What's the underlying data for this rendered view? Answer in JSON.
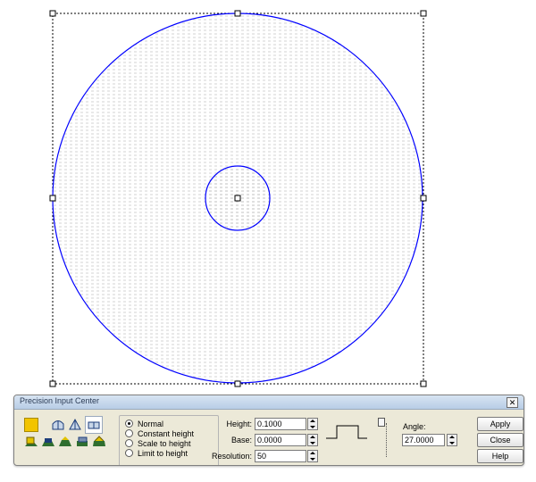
{
  "dialog": {
    "title": "Precision Input Center",
    "close_glyph": "✕",
    "modes": [
      {
        "label": "Normal",
        "selected": true
      },
      {
        "label": "Constant height",
        "selected": false
      },
      {
        "label": "Scale to height",
        "selected": false
      },
      {
        "label": "Limit to height",
        "selected": false
      }
    ],
    "fields": {
      "height_label": "Height:",
      "height_value": "0.1000",
      "base_label": "Base:",
      "base_value": "0.0000",
      "resolution_label": "Resolution:",
      "resolution_value": "50",
      "angle_label": "Angle:",
      "angle_value": "27.0000"
    },
    "buttons": {
      "apply": "Apply",
      "close": "Close",
      "help": "Help"
    },
    "tools": [
      "fill-color-swatch",
      "dome-icon",
      "cone-icon",
      "flat-profile-icon",
      "extrude-icon-1",
      "extrude-icon-2",
      "extrude-icon-3",
      "extrude-icon-4",
      "extrude-icon-5"
    ],
    "colors": {
      "circle_stroke": "#0000ff",
      "hatch": "#b0b0b0",
      "swatch": "#f2c400"
    }
  }
}
